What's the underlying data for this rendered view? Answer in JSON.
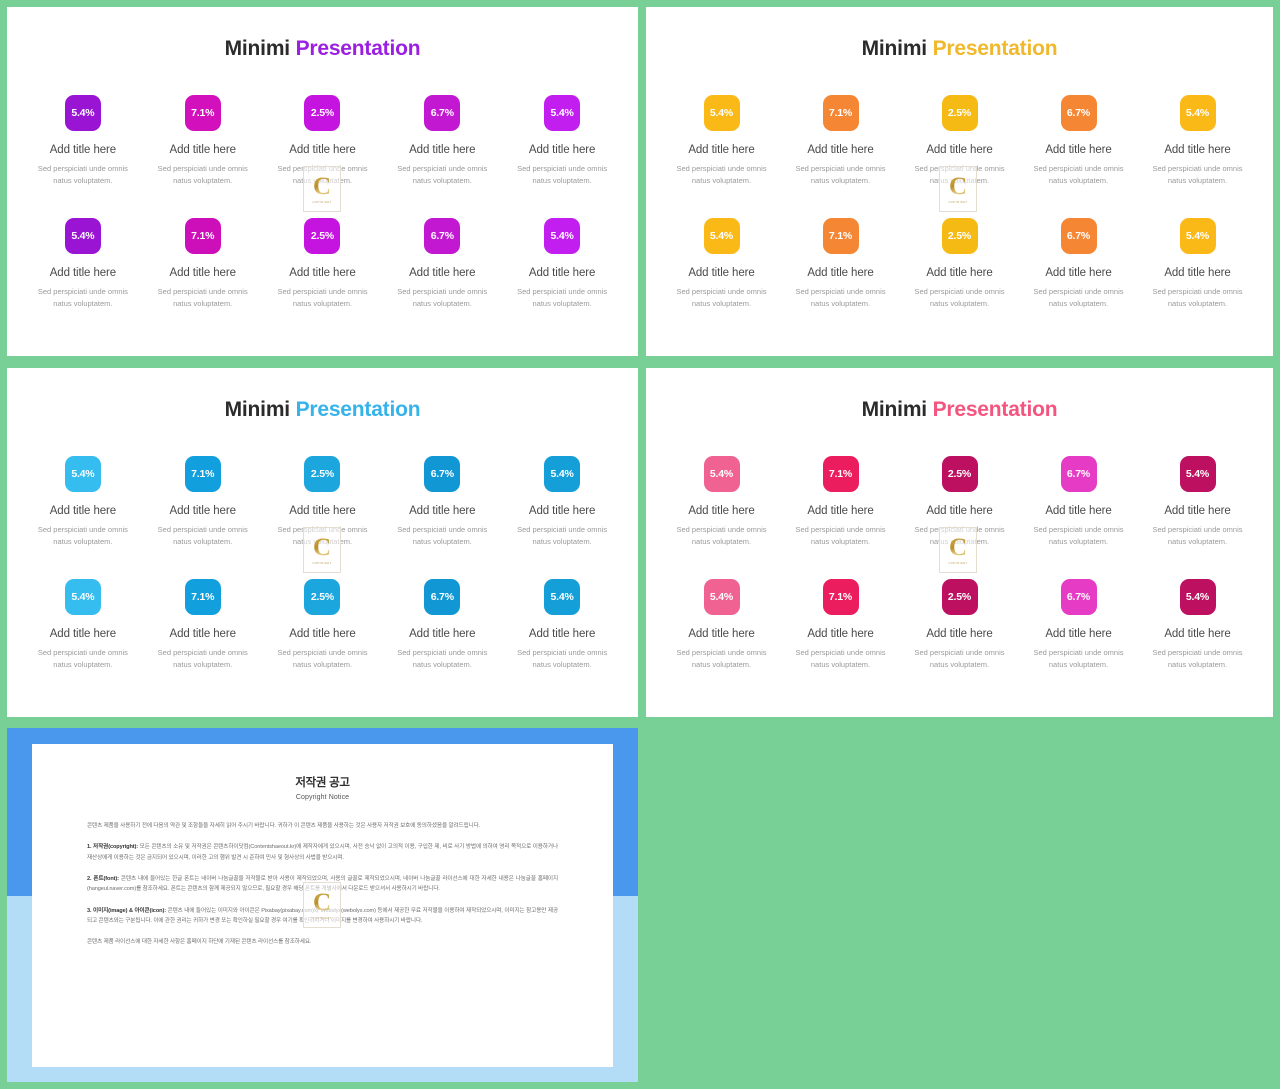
{
  "theme": {
    "background_green": "#79d096",
    "panel_white": "#ffffff",
    "frame_blue_top": "#4a97ee",
    "frame_blue_bottom": "#b3dcf7"
  },
  "watermark": {
    "letter": "C",
    "sublabel": "COPYRIGHT"
  },
  "common": {
    "title_primary": "Minimi",
    "title_accent": "Presentation",
    "card_title": "Add title here",
    "card_desc": "Sed perspiciati unde omnis natus voluptatem."
  },
  "slides": [
    {
      "id": "slide-purple",
      "title_primary": "Minimi",
      "title_accent": "Presentation",
      "accent_color": "#9b1fe0",
      "cards": [
        {
          "value": "5.4%",
          "color": "#9a14d4",
          "title": "Add title here",
          "desc": "Sed perspiciati unde omnis natus voluptatem."
        },
        {
          "value": "7.1%",
          "color": "#d211bd",
          "title": "Add title here",
          "desc": "Sed perspiciati unde omnis natus voluptatem."
        },
        {
          "value": "2.5%",
          "color": "#c514e0",
          "title": "Add title here",
          "desc": "Sed perspiciati unde omnis natus voluptatem."
        },
        {
          "value": "6.7%",
          "color": "#c218d2",
          "title": "Add title here",
          "desc": "Sed perspiciati unde omnis natus voluptatem."
        },
        {
          "value": "5.4%",
          "color": "#c21ef0",
          "title": "Add title here",
          "desc": "Sed perspiciati unde omnis natus voluptatem."
        },
        {
          "value": "5.4%",
          "color": "#9a14d4",
          "title": "Add title here",
          "desc": "Sed perspiciati unde omnis natus voluptatem."
        },
        {
          "value": "7.1%",
          "color": "#cc0fb9",
          "title": "Add title here",
          "desc": "Sed perspiciati unde omnis natus voluptatem."
        },
        {
          "value": "2.5%",
          "color": "#c514e0",
          "title": "Add title here",
          "desc": "Sed perspiciati unde omnis natus voluptatem."
        },
        {
          "value": "6.7%",
          "color": "#c218d2",
          "title": "Add title here",
          "desc": "Sed perspiciati unde omnis natus voluptatem."
        },
        {
          "value": "5.4%",
          "color": "#c21ef0",
          "title": "Add title here",
          "desc": "Sed perspiciati unde omnis natus voluptatem."
        }
      ]
    },
    {
      "id": "slide-amber",
      "title_primary": "Minimi",
      "title_accent": "Presentation",
      "accent_color": "#f0b92c",
      "cards": [
        {
          "value": "5.4%",
          "color": "#fbb917",
          "title": "Add title here",
          "desc": "Sed perspiciati unde omnis natus voluptatem."
        },
        {
          "value": "7.1%",
          "color": "#f58634",
          "title": "Add title here",
          "desc": "Sed perspiciati unde omnis natus voluptatem."
        },
        {
          "value": "2.5%",
          "color": "#f5bb14",
          "title": "Add title here",
          "desc": "Sed perspiciati unde omnis natus voluptatem."
        },
        {
          "value": "6.7%",
          "color": "#f58634",
          "title": "Add title here",
          "desc": "Sed perspiciati unde omnis natus voluptatem."
        },
        {
          "value": "5.4%",
          "color": "#fbb917",
          "title": "Add title here",
          "desc": "Sed perspiciati unde omnis natus voluptatem."
        },
        {
          "value": "5.4%",
          "color": "#fbb917",
          "title": "Add title here",
          "desc": "Sed perspiciati unde omnis natus voluptatem."
        },
        {
          "value": "7.1%",
          "color": "#f58634",
          "title": "Add title here",
          "desc": "Sed perspiciati unde omnis natus voluptatem."
        },
        {
          "value": "2.5%",
          "color": "#f5bb14",
          "title": "Add title here",
          "desc": "Sed perspiciati unde omnis natus voluptatem."
        },
        {
          "value": "6.7%",
          "color": "#f58634",
          "title": "Add title here",
          "desc": "Sed perspiciati unde omnis natus voluptatem."
        },
        {
          "value": "5.4%",
          "color": "#fbb917",
          "title": "Add title here",
          "desc": "Sed perspiciati unde omnis natus voluptatem."
        }
      ]
    },
    {
      "id": "slide-blue",
      "title_primary": "Minimi",
      "title_accent": "Presentation",
      "accent_color": "#36b4ea",
      "cards": [
        {
          "value": "5.4%",
          "color": "#35bdf0",
          "title": "Add title here",
          "desc": "Sed perspiciati unde omnis natus voluptatem."
        },
        {
          "value": "7.1%",
          "color": "#129fdd",
          "title": "Add title here",
          "desc": "Sed perspiciati unde omnis natus voluptatem."
        },
        {
          "value": "2.5%",
          "color": "#1ba6de",
          "title": "Add title here",
          "desc": "Sed perspiciati unde omnis natus voluptatem."
        },
        {
          "value": "6.7%",
          "color": "#1197d4",
          "title": "Add title here",
          "desc": "Sed perspiciati unde omnis natus voluptatem."
        },
        {
          "value": "5.4%",
          "color": "#159fd9",
          "title": "Add title here",
          "desc": "Sed perspiciati unde omnis natus voluptatem."
        },
        {
          "value": "5.4%",
          "color": "#35bdf0",
          "title": "Add title here",
          "desc": "Sed perspiciati unde omnis natus voluptatem."
        },
        {
          "value": "7.1%",
          "color": "#129fdd",
          "title": "Add title here",
          "desc": "Sed perspiciati unde omnis natus voluptatem."
        },
        {
          "value": "2.5%",
          "color": "#1ba6de",
          "title": "Add title here",
          "desc": "Sed perspiciati unde omnis natus voluptatem."
        },
        {
          "value": "6.7%",
          "color": "#1197d4",
          "title": "Add title here",
          "desc": "Sed perspiciati unde omnis natus voluptatem."
        },
        {
          "value": "5.4%",
          "color": "#159fd9",
          "title": "Add title here",
          "desc": "Sed perspiciati unde omnis natus voluptatem."
        }
      ]
    },
    {
      "id": "slide-pink",
      "title_primary": "Minimi",
      "title_accent": "Presentation",
      "accent_color": "#f4557f",
      "cards": [
        {
          "value": "5.4%",
          "color": "#f06292",
          "title": "Add title here",
          "desc": "Sed perspiciati unde omnis natus voluptatem."
        },
        {
          "value": "7.1%",
          "color": "#ec1d5e",
          "title": "Add title here",
          "desc": "Sed perspiciati unde omnis natus voluptatem."
        },
        {
          "value": "2.5%",
          "color": "#bd1060",
          "title": "Add title here",
          "desc": "Sed perspiciati unde omnis natus voluptatem."
        },
        {
          "value": "6.7%",
          "color": "#e63bc4",
          "title": "Add title here",
          "desc": "Sed perspiciati unde omnis natus voluptatem."
        },
        {
          "value": "5.4%",
          "color": "#bd1060",
          "title": "Add title here",
          "desc": "Sed perspiciati unde omnis natus voluptatem."
        },
        {
          "value": "5.4%",
          "color": "#f06292",
          "title": "Add title here",
          "desc": "Sed perspiciati unde omnis natus voluptatem."
        },
        {
          "value": "7.1%",
          "color": "#ec1d5e",
          "title": "Add title here",
          "desc": "Sed perspiciati unde omnis natus voluptatem."
        },
        {
          "value": "2.5%",
          "color": "#bd1060",
          "title": "Add title here",
          "desc": "Sed perspiciati unde omnis natus voluptatem."
        },
        {
          "value": "6.7%",
          "color": "#e63bc4",
          "title": "Add title here",
          "desc": "Sed perspiciati unde omnis natus voluptatem."
        },
        {
          "value": "5.4%",
          "color": "#bd1060",
          "title": "Add title here",
          "desc": "Sed perspiciati unde omnis natus voluptatem."
        }
      ]
    }
  ],
  "copyright_document": {
    "title": "저작권 공고",
    "subtitle": "Copyright Notice",
    "intro": "콘텐츠 제품을 사용하기 전에 다음의 약관 및 조항들을 자세히 읽어 주시기 바랍니다. 귀하가 이 콘텐츠 제품을 사용하는 것은 사용자 저작권 보호에 동의하셨음을 알려드립니다.",
    "sections": [
      {
        "label": "1. 저작권(copyright):",
        "text": " 모든 콘텐츠의 소유 및 저작권은 콘텐츠하이닷컴(Contentshaeout.kr)에 제작자에게 있으시며, 사전 승낙 없이 고의적 이용, 구입한 제, 비로 사기 방법에 의하여 영리 목적으로 이용하거나 재산상에게 이용하는 것은 금지되어 있으시며, 이러한 고의 행위 발견 시 준하여 민사 및 형사상의 사법을 받으시며."
      },
      {
        "label": "2. 폰트(font):",
        "text": " 콘텐츠 내에 들어있는 한글 폰트는 네이버 나눔글꼴을 저작물로 받아 사용이 제작되었으며, 사용의 글꼴로 제작되었으시며, 네이버 나눔글꼴 라이선스에 대한 자세한 내용은 나눔글꼴 홈페이지(hangeul.naver.com)를 참조하세요. 폰트는 콘텐츠의 함께 제공되지 않으므로, 필요할 경우 해당 폰트를 개별사에서 다운로드 받으셔서 사용하시기 바랍니다."
      },
      {
        "label": "3. 이미지(image) & 아이콘(icon):",
        "text": " 콘텐츠 내에 들어있는 이미지와 아이콘은 Pixabay(pixabay.com)와 Webolys(webolys.com) 등에서 제공한 무료 저작물을 이용하여 제작되었으시며, 이미지는 참고용만 제공되고 콘텐츠와는 구분됩니다. 이에 관한 권리는 귀하가 변경 또는 확인하실 필요할 경우 여기를 확인하시거나 이미지를 변경하여 사용하시기 바랍니다."
      }
    ],
    "footer": "콘텐츠 제품 라이선스에 대한 자세한 사항은 홈페이지 하단에 기재된 콘텐츠 라이선스를 참조하세요."
  }
}
